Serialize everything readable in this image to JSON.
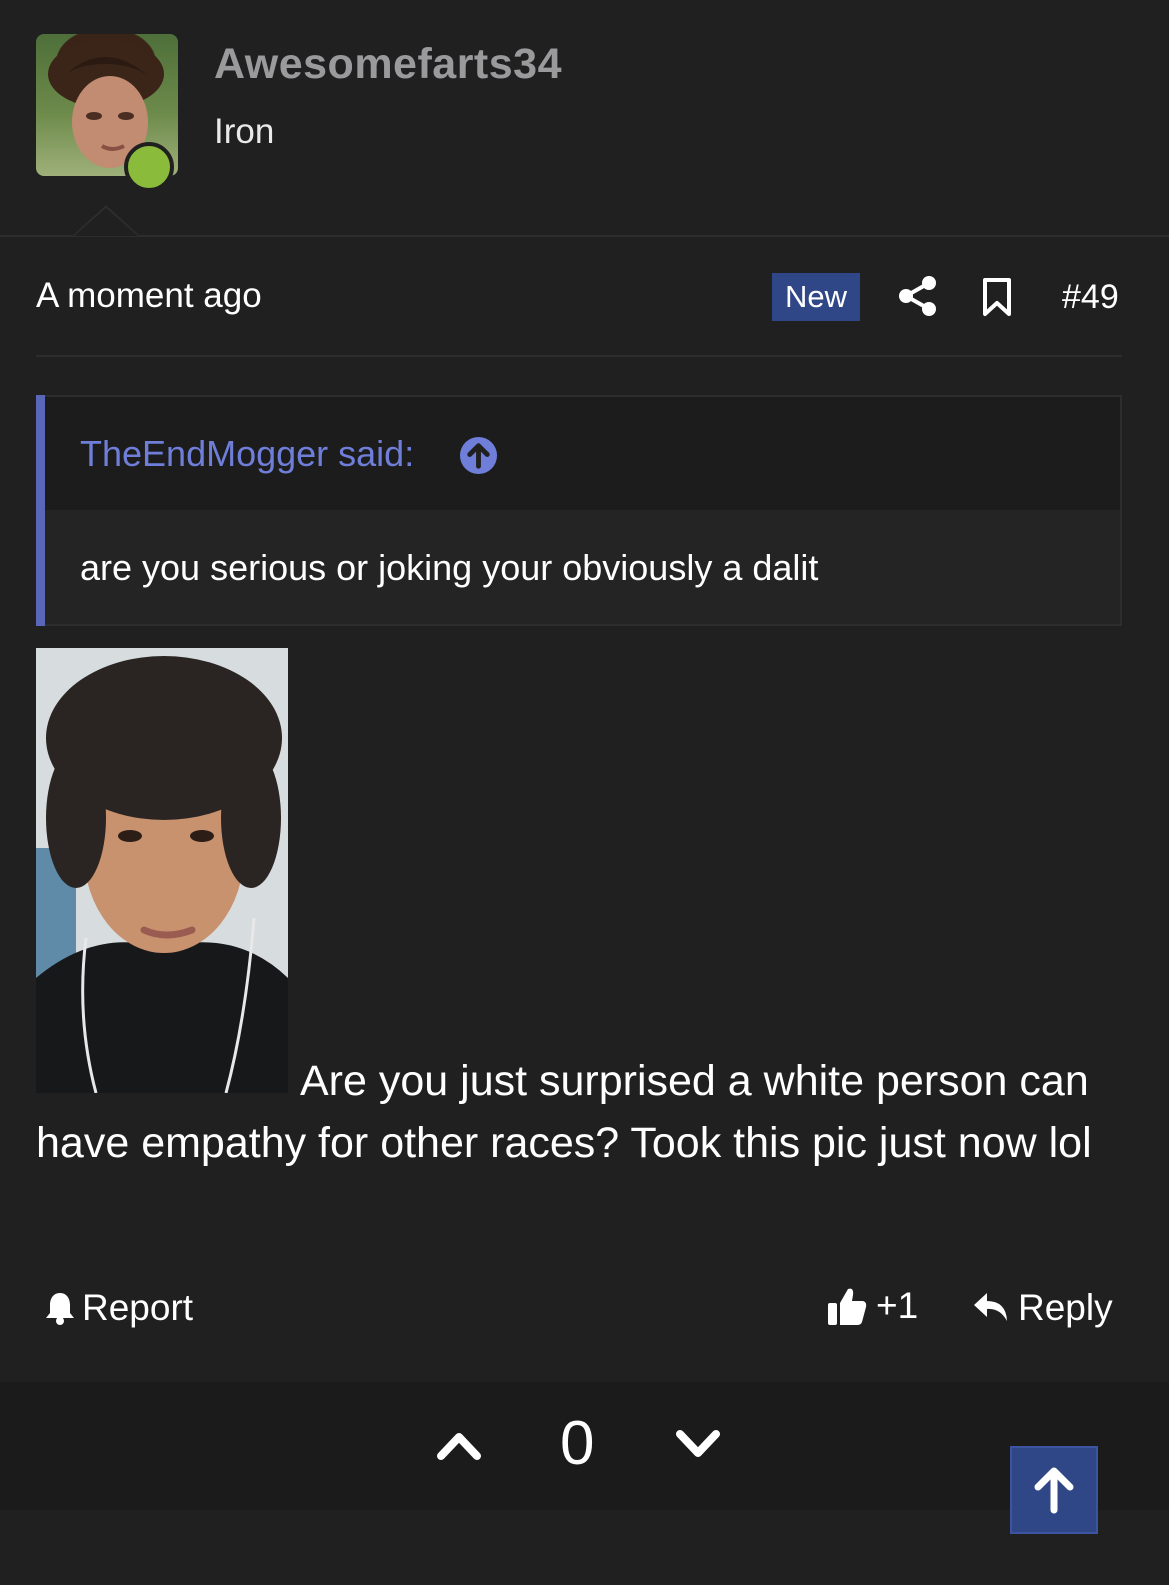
{
  "user": {
    "name": "Awesomefarts34",
    "rank": "Iron",
    "online_color": "#8bbb3b"
  },
  "meta": {
    "time": "A moment ago",
    "badge": "New",
    "post_number": "#49"
  },
  "quote": {
    "author_said": "TheEndMogger said:",
    "text": "are you serious or joking your obviously a dalit"
  },
  "post": {
    "text": "Are you just surprised a white person can have empathy for other races? Took this pic just now lol"
  },
  "actions": {
    "report": "Report",
    "like_count": "+1",
    "reply": "Reply"
  },
  "vote": {
    "count": "0"
  },
  "colors": {
    "accent": "#2f4687",
    "quote_accent": "#5a66b8",
    "link": "#6f7fd9",
    "background": "#202021"
  }
}
